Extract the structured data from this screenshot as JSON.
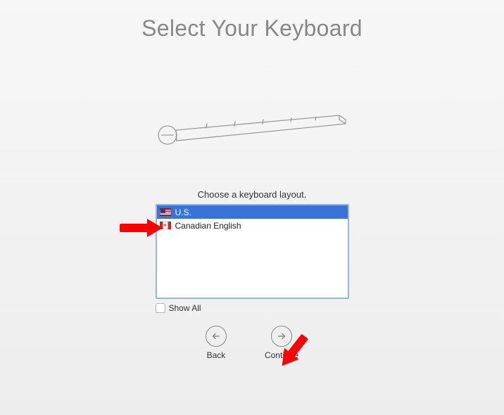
{
  "title": "Select Your Keyboard",
  "instruction": "Choose a keyboard layout.",
  "layouts": [
    {
      "label": "U.S.",
      "flag": "us",
      "selected": true
    },
    {
      "label": "Canadian English",
      "flag": "ca",
      "selected": false
    }
  ],
  "showall_label": "Show All",
  "showall_checked": false,
  "nav": {
    "back_label": "Back",
    "continue_label": "Continue"
  }
}
